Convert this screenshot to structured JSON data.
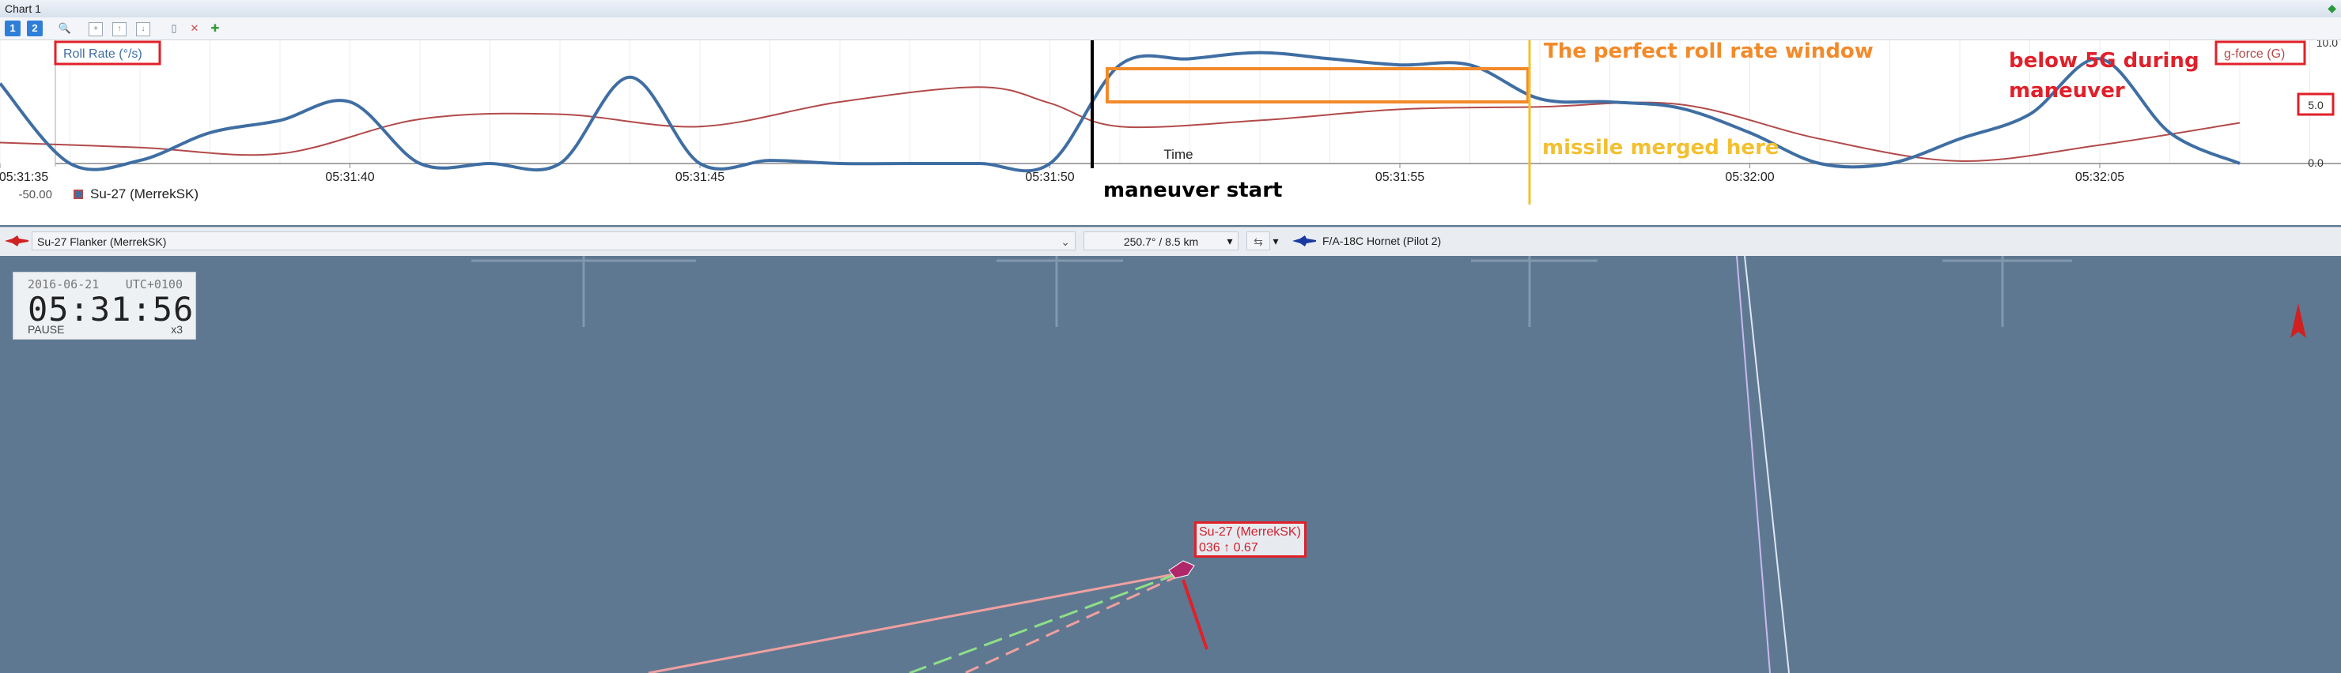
{
  "window": {
    "title": "Chart 1"
  },
  "toolbar": {
    "btn1": "1",
    "btn2": "2"
  },
  "chart": {
    "left_axis_label": "Roll Rate (°/s)",
    "right_axis_label": "g-force (G)",
    "left_axis_min": "-50.00",
    "right_tick_top": "10.0",
    "right_tick_mid": "5.0",
    "right_tick_low": "0.0",
    "x_axis_title": "Time",
    "x_tick_labels": [
      "05:31:35",
      "05:31:40",
      "05:31:45",
      "05:31:50",
      "05:31:55",
      "05:32:00",
      "05:32:05"
    ],
    "legend": "Su-27 (MerrekSK)",
    "colors": {
      "roll": "#3f6ea3",
      "gforce": "#b24a4a",
      "maneuver": "#000000",
      "window": "#f28a2a",
      "missile": "#f2c030",
      "annotation": "#e0202a"
    }
  },
  "chart_data": {
    "type": "line",
    "series": [
      {
        "name": "Roll Rate (°/s)",
        "x": [
          "05:31:35",
          "05:31:36",
          "05:31:37",
          "05:31:38",
          "05:31:39",
          "05:31:40",
          "05:31:41",
          "05:31:42",
          "05:31:43",
          "05:31:44",
          "05:31:45",
          "05:31:46",
          "05:31:47",
          "05:31:48",
          "05:31:49",
          "05:31:50",
          "05:31:51",
          "05:31:52",
          "05:31:53",
          "05:31:54",
          "05:31:55",
          "05:31:56",
          "05:31:57",
          "05:31:58",
          "05:31:59",
          "05:32:00",
          "05:32:01",
          "05:32:02",
          "05:32:03",
          "05:32:04",
          "05:32:05",
          "05:32:06",
          "05:32:07"
        ],
        "y": [
          80,
          -50,
          -45,
          0,
          20,
          50,
          -50,
          -50,
          -50,
          90,
          -50,
          -45,
          -50,
          -50,
          -50,
          -50,
          110,
          120,
          130,
          120,
          110,
          110,
          55,
          50,
          40,
          0,
          -50,
          -50,
          -10,
          30,
          120,
          0,
          -50
        ]
      },
      {
        "name": "g-force (G)",
        "x": [
          "05:31:35",
          "05:31:37",
          "05:31:39",
          "05:31:41",
          "05:31:43",
          "05:31:45",
          "05:31:47",
          "05:31:49",
          "05:31:50",
          "05:31:51",
          "05:31:53",
          "05:31:55",
          "05:31:57",
          "05:31:59",
          "05:32:01",
          "05:32:03",
          "05:32:05",
          "05:32:07"
        ],
        "y": [
          1.7,
          1.3,
          0.8,
          3.6,
          4.0,
          3.0,
          5.0,
          6.2,
          4.9,
          3.0,
          3.5,
          4.4,
          4.6,
          4.8,
          2.0,
          0.2,
          1.5,
          3.3
        ]
      }
    ],
    "ylim_left": [
      -50,
      150
    ],
    "ylim_right": [
      0,
      10
    ]
  },
  "annotations": {
    "maneuver_start": "maneuver start",
    "roll_window": "The perfect roll rate window",
    "missile_merged": "missile merged here",
    "g_note_line1": "below 5G during",
    "g_note_line2": "maneuver"
  },
  "selection_bar": {
    "left_aircraft": "Su-27 Flanker (MerrekSK)",
    "distance": "250.7° / 8.5 km",
    "right_aircraft": "F/A-18C Hornet (Pilot 2)"
  },
  "clock": {
    "date": "2016-06-21",
    "timezone": "UTC+0100",
    "time": "05:31:56",
    "state": "PAUSE",
    "speed": "x3"
  },
  "map": {
    "aircraft_name": "Su-27 (MerrekSK)",
    "aircraft_info": "036 ↑ 0.67"
  }
}
